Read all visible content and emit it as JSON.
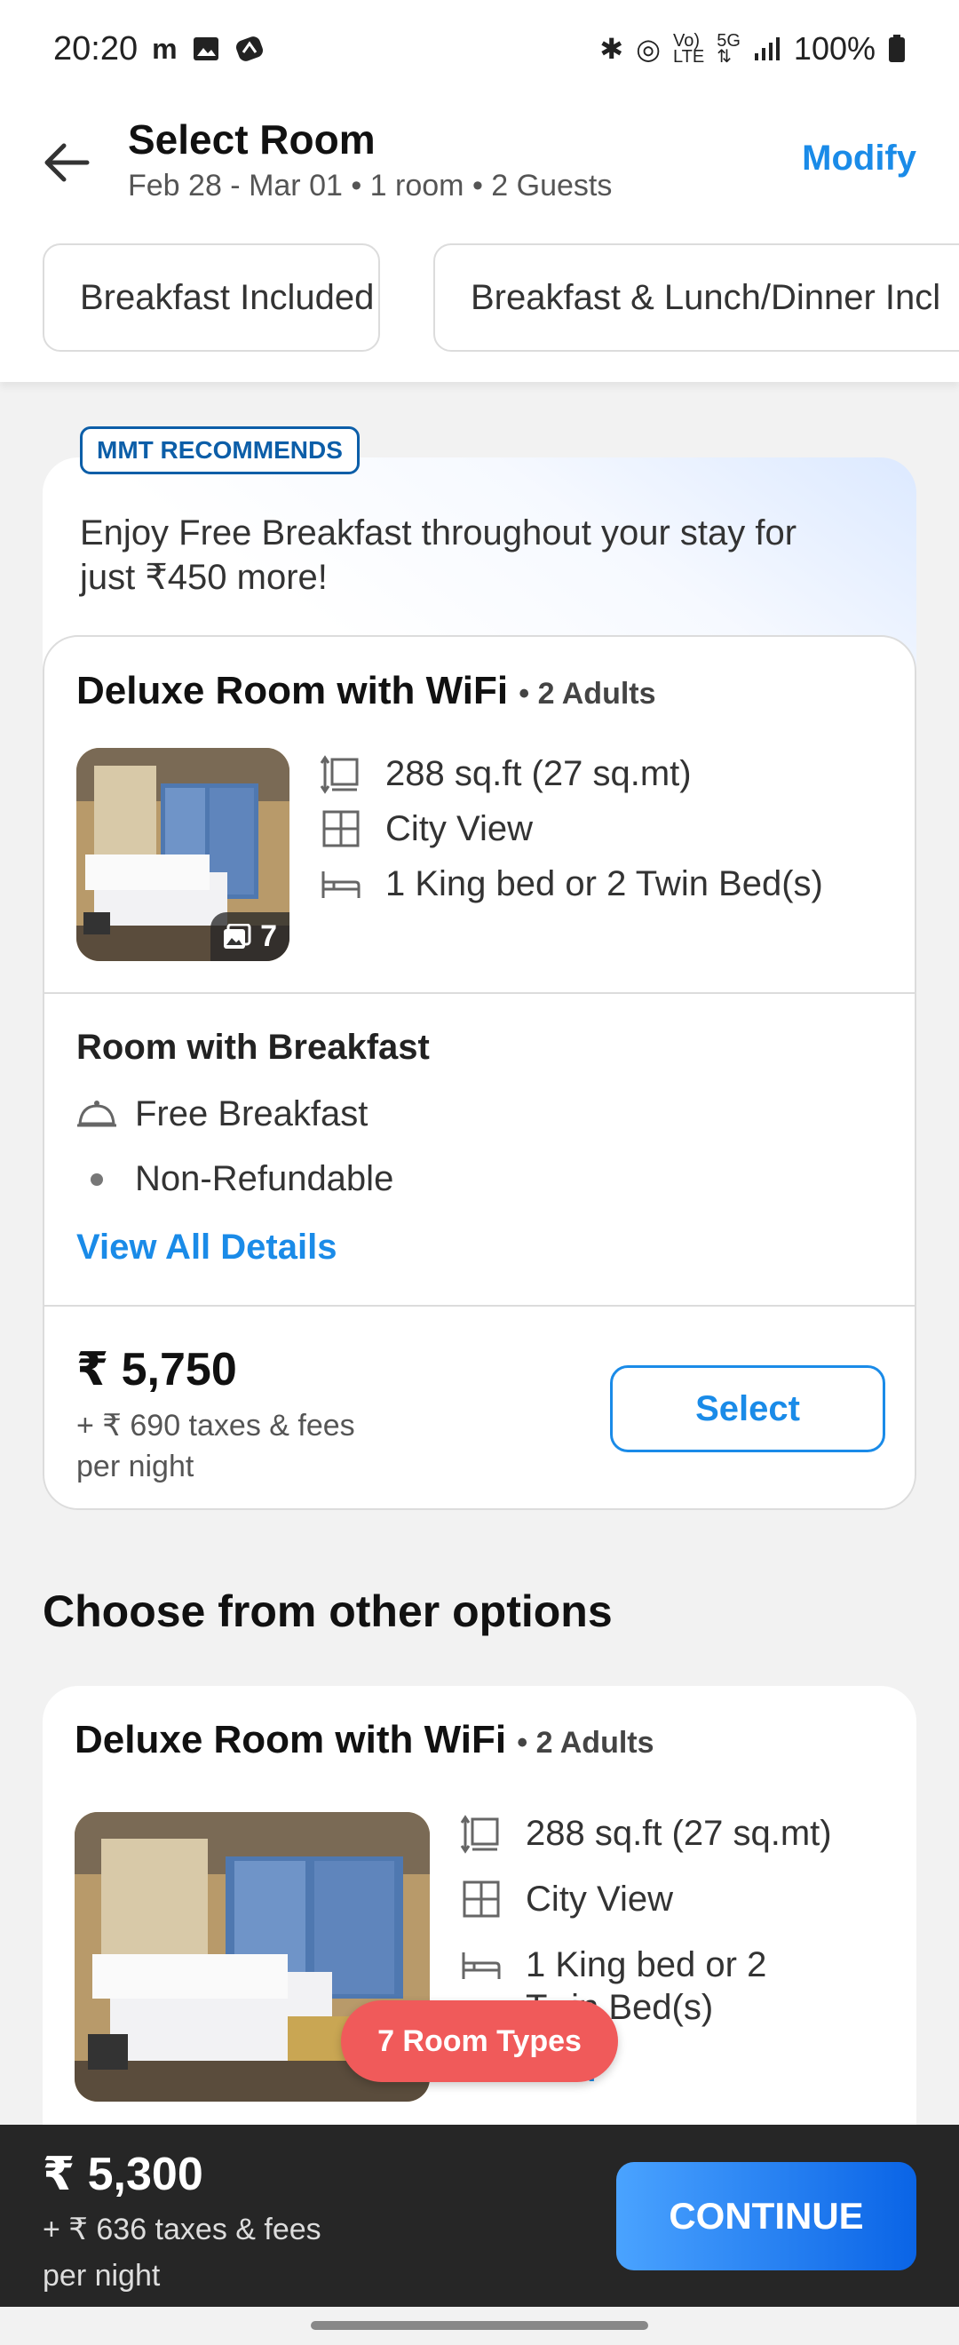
{
  "status_bar": {
    "time": "20:20",
    "battery": "100%"
  },
  "header": {
    "title": "Select Room",
    "subtitle": "Feb 28 - Mar 01 • 1 room • 2 Guests",
    "modify_label": "Modify"
  },
  "filters": [
    "Breakfast Included",
    "Breakfast & Lunch/Dinner Incl"
  ],
  "recommendation": {
    "badge": "MMT RECOMMENDS",
    "message": "Enjoy Free Breakfast throughout your stay for just ₹450 more!",
    "room": {
      "name": "Deluxe Room with WiFi",
      "occupancy": "• 2 Adults",
      "photo_count": "7",
      "features": [
        "288 sq.ft (27 sq.mt)",
        "City View",
        "1 King bed or 2 Twin Bed(s)"
      ],
      "plan_title": "Room with Breakfast",
      "inclusions": [
        "Free Breakfast",
        "Non-Refundable"
      ],
      "details_link": "View All Details",
      "price": "₹ 5,750",
      "taxes": "+ ₹ 690 taxes & fees",
      "per_night": "per night",
      "select_label": "Select"
    }
  },
  "other_options": {
    "section_title": "Choose from other options",
    "room": {
      "name": "Deluxe Room with WiFi",
      "occupancy": "• 2 Adults",
      "features": [
        "288 sq.ft (27 sq.mt)",
        "City View",
        "1 King bed or 2",
        "Twin Bed(s)"
      ],
      "view_all": "View All"
    }
  },
  "room_types_pill": "7 Room Types",
  "bottom_bar": {
    "price": "₹ 5,300",
    "taxes": "+ ₹ 636 taxes & fees",
    "per_night": "per night",
    "continue_label": "CONTINUE"
  },
  "colors": {
    "accent": "#1a8be8",
    "badge_border": "#0c5ea8",
    "pill": "#f05a5a",
    "bottom_bar": "#262626"
  }
}
